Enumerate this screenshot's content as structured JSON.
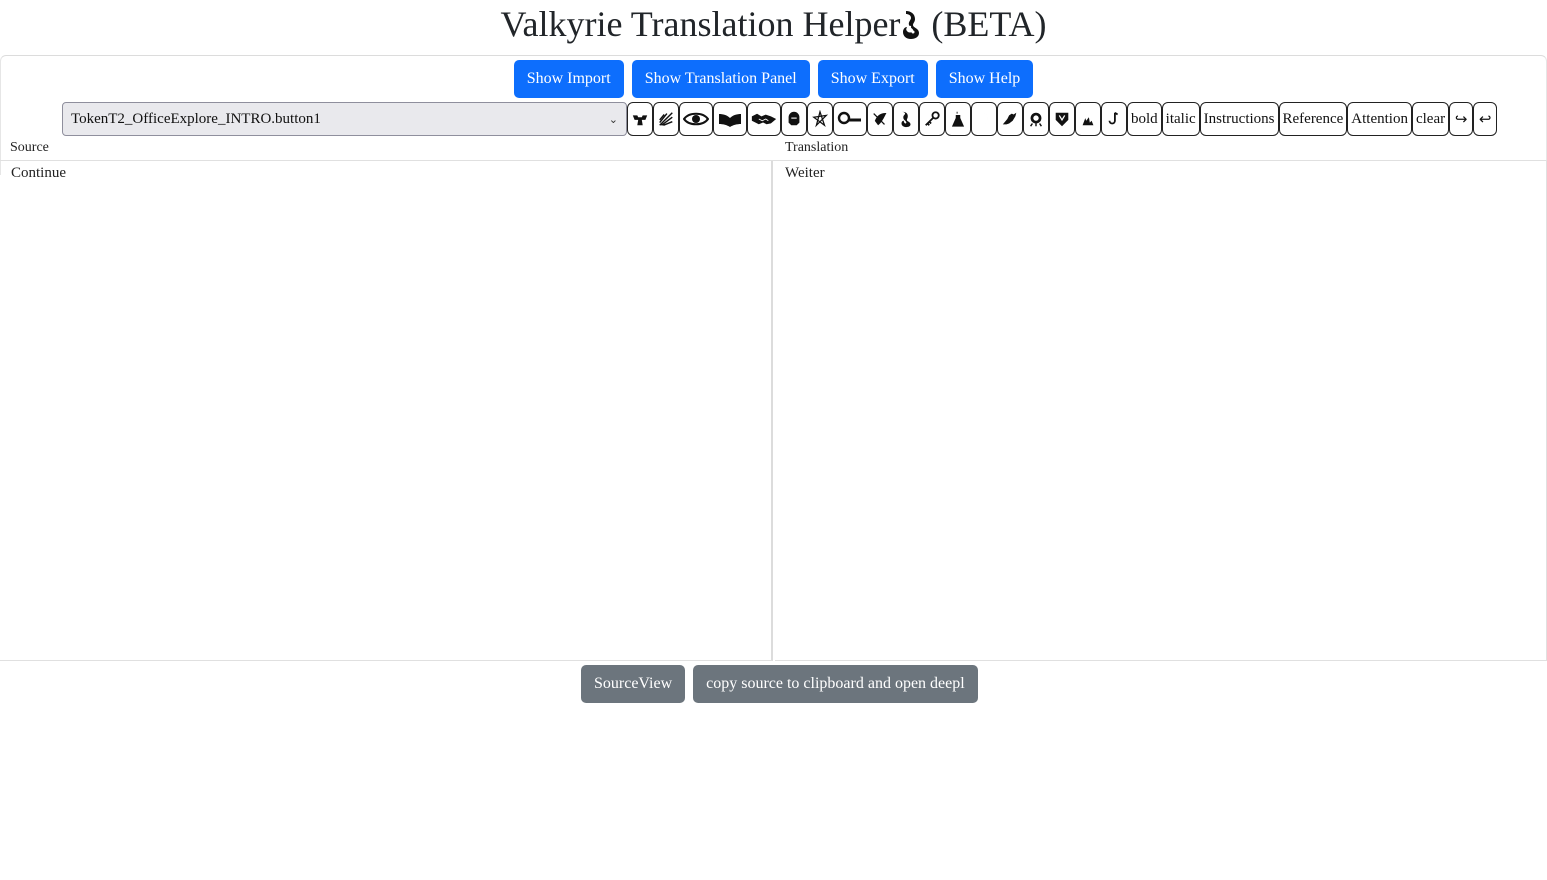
{
  "header": {
    "title": "Valkyrie Translation Helper",
    "title_icon": "tentacle-icon",
    "suffix": "(BETA)"
  },
  "top_buttons": [
    {
      "label": "Show Import"
    },
    {
      "label": "Show Translation Panel"
    },
    {
      "label": "Show Export"
    },
    {
      "label": "Show Help"
    }
  ],
  "colors": {
    "primary": "#0d6efd",
    "secondary": "#6c757d"
  },
  "toolbar": {
    "selected_key": "TokenT2_OfficeExplore_INTRO.button1",
    "symbol_buttons": [
      {
        "icon": "strength-icon"
      },
      {
        "icon": "agility-icon"
      },
      {
        "icon": "observation-icon"
      },
      {
        "icon": "lore-icon"
      },
      {
        "icon": "influence-icon"
      },
      {
        "icon": "will-icon"
      },
      {
        "icon": "elder-sign-icon"
      },
      {
        "icon": "magnifying-glass-icon"
      },
      {
        "icon": "success-icon"
      },
      {
        "icon": "tentacle-icon"
      },
      {
        "icon": "key-icon"
      },
      {
        "icon": "flask-icon"
      },
      {
        "icon": "moon-icon"
      },
      {
        "icon": "hand-icon"
      },
      {
        "icon": "skull-icon"
      },
      {
        "icon": "shield-icon"
      },
      {
        "icon": "fire-icon"
      },
      {
        "icon": "hook-icon"
      }
    ],
    "text_buttons": [
      {
        "label": "bold"
      },
      {
        "label": "italic"
      },
      {
        "label": "Instructions"
      },
      {
        "label": "Reference"
      },
      {
        "label": "Attention"
      },
      {
        "label": "clear"
      }
    ],
    "redo_icon": "redo-icon",
    "undo_icon": "undo-icon"
  },
  "source": {
    "label": "Source",
    "text": "Continue"
  },
  "translation": {
    "label": "Translation",
    "text": "Weiter"
  },
  "bottom_buttons": [
    {
      "label": "SourceView"
    },
    {
      "label": "copy source to clipboard and open deepl"
    }
  ]
}
